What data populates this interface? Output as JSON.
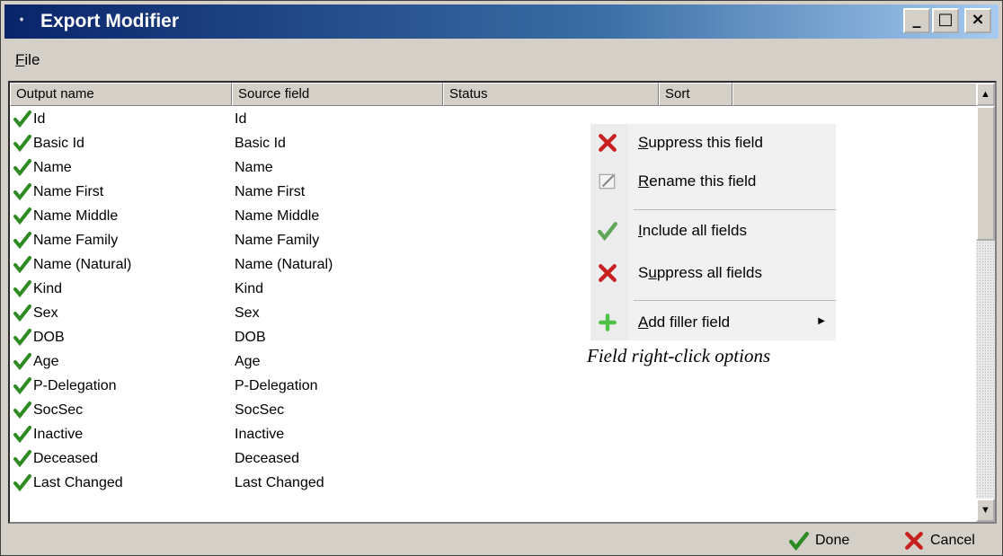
{
  "window": {
    "title": "Export Modifier",
    "controls": [
      "_",
      "□",
      "×"
    ]
  },
  "menubar": {
    "file_label_mnemonic": "F",
    "file_label_rest": "ile"
  },
  "columns": [
    "Output name",
    "Source field",
    "Status",
    "Sort"
  ],
  "rows": [
    {
      "output": "Id",
      "source": "Id"
    },
    {
      "output": "Basic Id",
      "source": "Basic Id"
    },
    {
      "output": "Name",
      "source": "Name"
    },
    {
      "output": "Name First",
      "source": "Name First"
    },
    {
      "output": "Name Middle",
      "source": "Name Middle"
    },
    {
      "output": "Name Family",
      "source": "Name Family"
    },
    {
      "output": "Name (Natural)",
      "source": "Name (Natural)"
    },
    {
      "output": "Kind",
      "source": "Kind"
    },
    {
      "output": "Sex",
      "source": "Sex"
    },
    {
      "output": "DOB",
      "source": "DOB"
    },
    {
      "output": "Age",
      "source": "Age"
    },
    {
      "output": "P-Delegation",
      "source": "P-Delegation"
    },
    {
      "output": "SocSec",
      "source": "SocSec"
    },
    {
      "output": "Inactive",
      "source": "Inactive"
    },
    {
      "output": "Deceased",
      "source": "Deceased"
    },
    {
      "output": "Last Changed",
      "source": "Last Changed"
    }
  ],
  "context_menu": {
    "items": [
      {
        "mnemonic": "S",
        "rest": "uppress this field",
        "icon": "red-x-icon"
      },
      {
        "mnemonic": "R",
        "rest": "ename this field",
        "icon": "rename-icon"
      },
      {
        "mnemonic": "I",
        "rest": "nclude all fields",
        "icon": "green-check-icon"
      },
      {
        "prefix": "S",
        "mnemonic": "u",
        "rest": "ppress all fields",
        "icon": "red-x-icon"
      },
      {
        "mnemonic": "A",
        "rest": "dd filler field",
        "icon": "green-plus-icon"
      }
    ]
  },
  "caption": "Field right-click options",
  "footer": {
    "done_label": "Done",
    "cancel_label": "Cancel"
  },
  "colors": {
    "check_green": "#2e8b22",
    "x_red": "#c8201e",
    "title_blue": "#0a246a"
  }
}
